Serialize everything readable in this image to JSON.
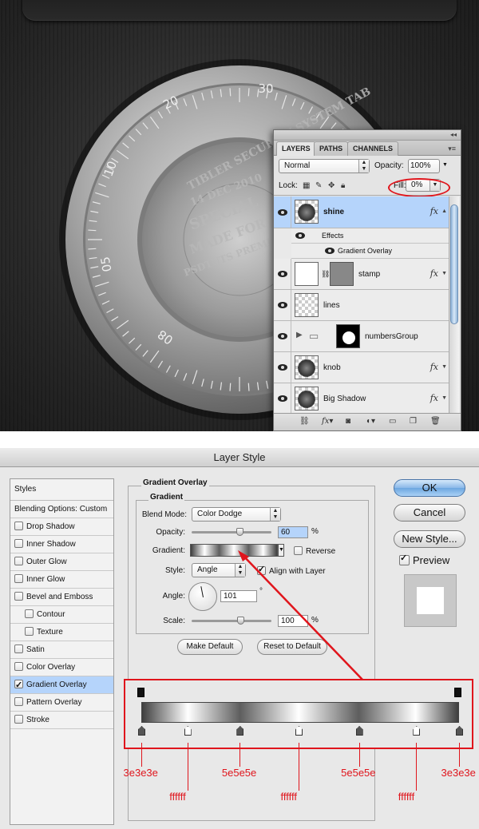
{
  "scene": {
    "dial_numbers": [
      "30",
      "20",
      "10",
      "05",
      "08"
    ],
    "stamp_lines": [
      "TIBLER SECURITY SYSTEM TAB",
      "PSDTUTS PREMIUM TUTORIAL",
      "14 DEC 2010",
      "SPECIAL",
      "MADE FOR"
    ]
  },
  "layers_panel": {
    "tabs": [
      "LAYERS",
      "PATHS",
      "CHANNELS"
    ],
    "menu_icon": "panel-menu-icon",
    "blend_mode": "Normal",
    "opacity_label": "Opacity:",
    "opacity_value": "100%",
    "lock_label": "Lock:",
    "fill_label": "Fill:",
    "fill_value": "0%",
    "layers": [
      {
        "name": "shine",
        "selected": true,
        "fx": "fx"
      },
      {
        "name": "Effects"
      },
      {
        "name": "Gradient Overlay"
      },
      {
        "name": "stamp",
        "fx": "fx"
      },
      {
        "name": "lines"
      },
      {
        "name": "numbersGroup"
      },
      {
        "name": "knob",
        "fx": "fx"
      },
      {
        "name": "Big Shadow",
        "fx": "fx"
      }
    ],
    "bottom_icons": [
      "link-icon",
      "fx-icon",
      "mask-icon",
      "adjustment-icon",
      "folder-icon",
      "new-layer-icon",
      "trash-icon"
    ]
  },
  "dialog": {
    "title": "Layer Style",
    "styles_header": "Styles",
    "blending_options": "Blending Options: Custom",
    "style_items": [
      {
        "label": "Drop Shadow",
        "checked": false
      },
      {
        "label": "Inner Shadow",
        "checked": false
      },
      {
        "label": "Outer Glow",
        "checked": false
      },
      {
        "label": "Inner Glow",
        "checked": false
      },
      {
        "label": "Bevel and Emboss",
        "checked": false
      },
      {
        "label": "Contour",
        "checked": false
      },
      {
        "label": "Texture",
        "checked": false
      },
      {
        "label": "Satin",
        "checked": false
      },
      {
        "label": "Color Overlay",
        "checked": false
      },
      {
        "label": "Gradient Overlay",
        "checked": true
      },
      {
        "label": "Pattern Overlay",
        "checked": false
      },
      {
        "label": "Stroke",
        "checked": false
      }
    ],
    "section_title": "Gradient Overlay",
    "subsection_title": "Gradient",
    "blend_mode_label": "Blend Mode:",
    "blend_mode_value": "Color Dodge",
    "opacity_label": "Opacity:",
    "opacity_value": "60",
    "opacity_fraction": 0.6,
    "percent": "%",
    "gradient_label": "Gradient:",
    "reverse_label": "Reverse",
    "style_label": "Style:",
    "style_value": "Angle",
    "align_label": "Align with Layer",
    "angle_label": "Angle:",
    "angle_value": "101",
    "degree": "°",
    "scale_label": "Scale:",
    "scale_value": "100",
    "make_default": "Make Default",
    "reset_default": "Reset to Default",
    "ok": "OK",
    "cancel": "Cancel",
    "new_style": "New Style...",
    "preview_label": "Preview",
    "gradient_stops": [
      "3e3e3e",
      "ffffff",
      "5e5e5e",
      "ffffff",
      "5e5e5e",
      "ffffff",
      "3e3e3e"
    ],
    "accent_color": "#e0151c"
  }
}
